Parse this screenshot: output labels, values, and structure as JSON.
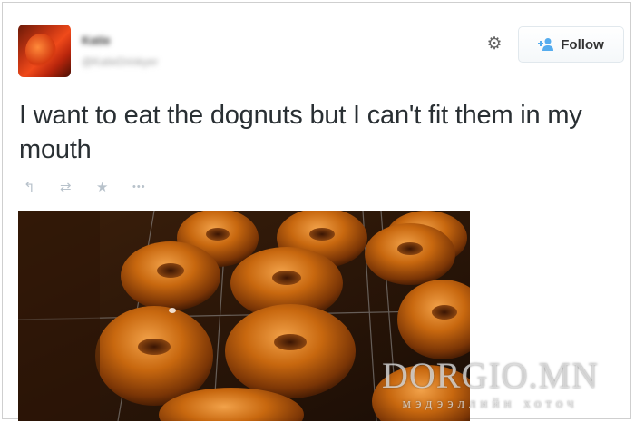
{
  "tweet": {
    "author_name": "Katie",
    "author_handle": "@KatieDrinkyer",
    "follow_label": "Follow",
    "text": "I want to eat the dognuts but I can't fit them in my mouth",
    "actions": [
      {
        "icon": "reply-icon",
        "glyph": "↰"
      },
      {
        "icon": "retweet-icon",
        "glyph": "⇄"
      },
      {
        "icon": "favorite-icon",
        "glyph": "★"
      },
      {
        "icon": "more-icon",
        "glyph": "•••"
      }
    ],
    "settings_icon": "gear-icon",
    "colors": {
      "text": "#292f33",
      "icon": "#b8c2cb",
      "follow_icon": "#55acee"
    }
  },
  "watermark": {
    "main": "DORGIO.MN",
    "sub": "мэдээллийн хоточ"
  }
}
